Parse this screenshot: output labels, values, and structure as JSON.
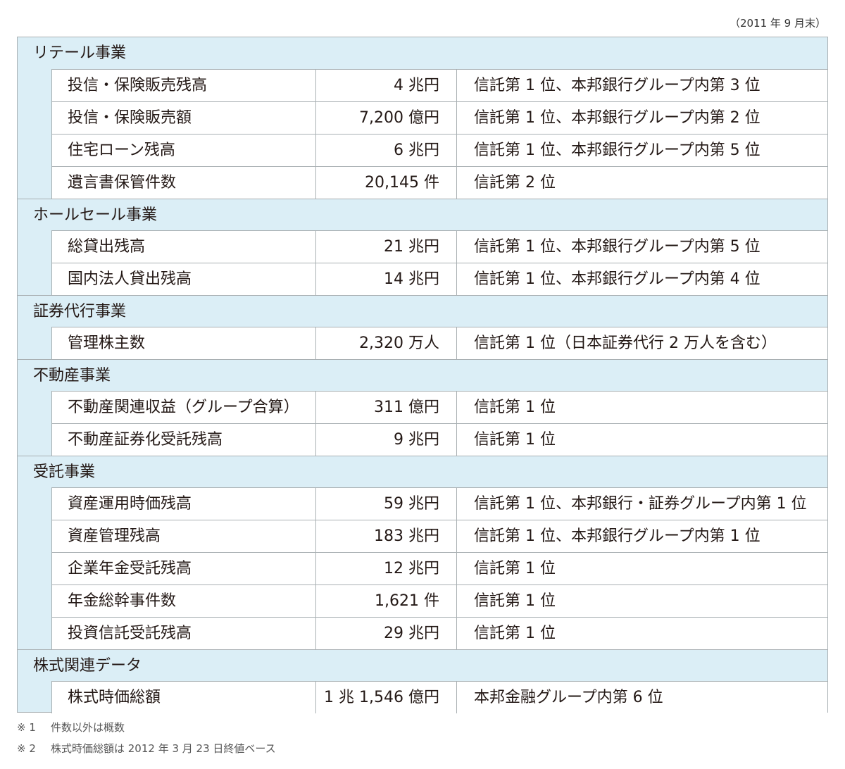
{
  "date_note": "（2011 年 9 月末）",
  "sections": [
    {
      "title": "リテール事業",
      "rows": [
        {
          "label": "投信・保険販売残高",
          "value": "4 兆円",
          "rank": "信託第 1 位、本邦銀行グループ内第 3 位"
        },
        {
          "label": "投信・保険販売額",
          "value": "7,200 億円",
          "rank": "信託第 1 位、本邦銀行グループ内第 2 位"
        },
        {
          "label": "住宅ローン残高",
          "value": "6 兆円",
          "rank": "信託第 1 位、本邦銀行グループ内第 5 位"
        },
        {
          "label": "遺言書保管件数",
          "value": "20,145 件",
          "rank": "信託第 2 位"
        }
      ]
    },
    {
      "title": "ホールセール事業",
      "rows": [
        {
          "label": "総貸出残高",
          "value": "21 兆円",
          "rank": "信託第 1 位、本邦銀行グループ内第 5 位"
        },
        {
          "label": "国内法人貸出残高",
          "value": "14 兆円",
          "rank": "信託第 1 位、本邦銀行グループ内第 4 位"
        }
      ]
    },
    {
      "title": "証券代行事業",
      "rows": [
        {
          "label": "管理株主数",
          "value": "2,320 万人",
          "rank": "信託第 1 位（日本証券代行 2 万人を含む）"
        }
      ]
    },
    {
      "title": "不動産事業",
      "rows": [
        {
          "label": "不動産関連収益（グループ合算）",
          "value": "311 億円",
          "rank": "信託第 1 位"
        },
        {
          "label": "不動産証券化受託残高",
          "value": "9 兆円",
          "rank": "信託第 1 位"
        }
      ]
    },
    {
      "title": "受託事業",
      "rows": [
        {
          "label": "資産運用時価残高",
          "value": "59 兆円",
          "rank": "信託第 1 位、本邦銀行・証券グループ内第 1 位"
        },
        {
          "label": "資産管理残高",
          "value": "183 兆円",
          "rank": "信託第 1 位、本邦銀行グループ内第 1 位"
        },
        {
          "label": "企業年金受託残高",
          "value": "12 兆円",
          "rank": "信託第 1 位"
        },
        {
          "label": "年金総幹事件数",
          "value": "1,621 件",
          "rank": "信託第 1 位"
        },
        {
          "label": "投資信託受託残高",
          "value": "29 兆円",
          "rank": "信託第 1 位"
        }
      ]
    },
    {
      "title": "株式関連データ",
      "rows": [
        {
          "label": "株式時価総額",
          "value": "1 兆 1,546 億円",
          "rank": "本邦金融グループ内第 6 位"
        }
      ]
    }
  ],
  "footnotes": [
    {
      "mark": "※ 1",
      "text": "件数以外は概数"
    },
    {
      "mark": "※ 2",
      "text": "株式時価総額は 2012 年 3 月 23 日終値ベース"
    }
  ]
}
